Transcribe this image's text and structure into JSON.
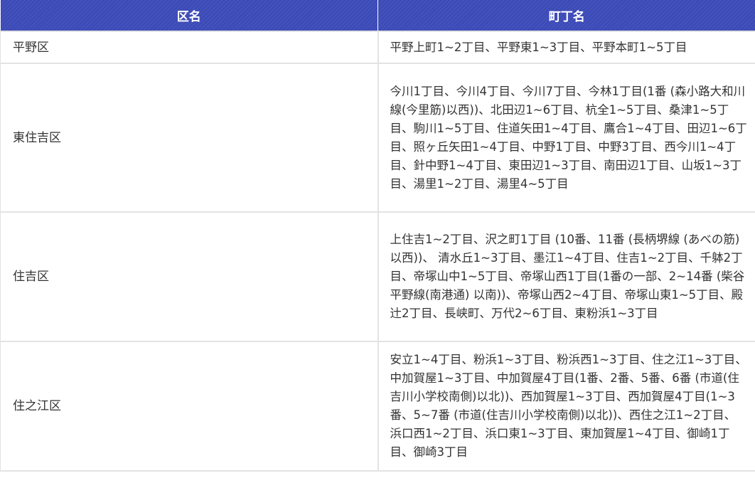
{
  "table": {
    "headers": [
      "区名",
      "町丁名"
    ],
    "rows": [
      {
        "ward": "平野区",
        "towns": "平野上町1~2丁目、平野東1~3丁目、平野本町1~5丁目"
      },
      {
        "ward": "東住吉区",
        "towns": "今川1丁目、今川4丁目、今川7丁目、今林1丁目(1番 (森小路大和川線(今里筋)以西))、北田辺1~6丁目、杭全1~5丁目、桑津1~5丁目、駒川1~5丁目、住道矢田1~4丁目、鷹合1~4丁目、田辺1~6丁目、照ヶ丘矢田1~4丁目、中野1丁目、中野3丁目、西今川1~4丁目、針中野1~4丁目、東田辺1~3丁目、南田辺1丁目、山坂1~3丁目、湯里1~2丁目、湯里4~5丁目"
      },
      {
        "ward": "住吉区",
        "towns": "上住吉1~2丁目、沢之町1丁目 (10番、11番 (長柄堺線 (あべの筋) 以西))、 清水丘1~3丁目、墨江1~4丁目、住吉1~2丁目、千躰2丁目、帝塚山中1~5丁目、帝塚山西1丁目(1番の一部、2~14番 (柴谷平野線(南港通) 以南))、帝塚山西2~4丁目、帝塚山東1~5丁目、殿辻2丁目、長峡町、万代2~6丁目、東粉浜1~3丁目"
      },
      {
        "ward": "住之江区",
        "towns": "安立1~4丁目、粉浜1~3丁目、粉浜西1~3丁目、住之江1~3丁目、中加賀屋1~3丁目、中加賀屋4丁目(1番、2番、5番、6番 (市道(住吉川小学校南側)以北))、西加賀屋1~3丁目、西加賀屋4丁目(1~3番、5~7番 (市道(住吉川小学校南側)以北))、西住之江1~2丁目、浜口西1~2丁目、浜口東1~3丁目、東加賀屋1~4丁目、御崎1丁目、御崎3丁目"
      }
    ]
  }
}
